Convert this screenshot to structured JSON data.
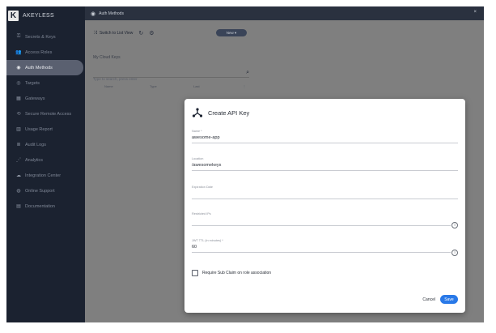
{
  "brand": {
    "logo_letter": "K",
    "name": "AKEYLESS"
  },
  "sidebar": {
    "items": [
      {
        "icon": "key-icon",
        "glyph": "⚿",
        "label": "Secrets & Keys"
      },
      {
        "icon": "users-icon",
        "glyph": "👥",
        "label": "Access Roles"
      },
      {
        "icon": "auth-methods-icon",
        "glyph": "◉",
        "label": "Auth Methods"
      },
      {
        "icon": "target-icon",
        "glyph": "◎",
        "label": "Targets"
      },
      {
        "icon": "gateway-icon",
        "glyph": "▦",
        "label": "Gateways"
      },
      {
        "icon": "remote-access-icon",
        "glyph": "⟲",
        "label": "Secure Remote Access"
      },
      {
        "icon": "usage-report-icon",
        "glyph": "▥",
        "label": "Usage Report"
      },
      {
        "icon": "audit-logs-icon",
        "glyph": "≣",
        "label": "Audit Logs"
      },
      {
        "icon": "analytics-icon",
        "glyph": "⋰",
        "label": "Analytics"
      },
      {
        "icon": "integration-icon",
        "glyph": "☁",
        "label": "Integration Center"
      },
      {
        "icon": "support-icon",
        "glyph": "◍",
        "label": "Online Support"
      },
      {
        "icon": "documentation-icon",
        "glyph": "▤",
        "label": "Documentation"
      }
    ],
    "active_index": 2
  },
  "topbar": {
    "title": "Auth Methods",
    "close_glyph": "×"
  },
  "toolbar": {
    "switch_label": "Switch to List View",
    "refresh_glyph": "↻",
    "settings_glyph": "⚙",
    "new_label": "New ▾"
  },
  "breadcrumb": "My Cloud Keys",
  "search": {
    "placeholder": "Type to search, press enter"
  },
  "table": {
    "headers": [
      "Name",
      "Type",
      "Last"
    ],
    "menu_glyph": "⋮"
  },
  "modal": {
    "title": "Create API Key",
    "fields": {
      "name": {
        "label": "Name *",
        "value": "awesome-app"
      },
      "location": {
        "label": "Location",
        "value": "/awesomekeys"
      },
      "expiration": {
        "label": "Expiration Date",
        "value": ""
      },
      "bound_ips": {
        "label": "Restricted IPs",
        "value": ""
      },
      "jwt_ttl": {
        "label": "JWT TTL (in minutes) *",
        "value": "60"
      }
    },
    "info_glyph": "i",
    "checkbox_label": "Require Sub Claim on role association",
    "cancel_label": "Cancel",
    "save_label": "Save"
  },
  "colors": {
    "sidebar": "#1b2230",
    "accent": "#2979e8",
    "overlay": "#7f7f7f"
  }
}
